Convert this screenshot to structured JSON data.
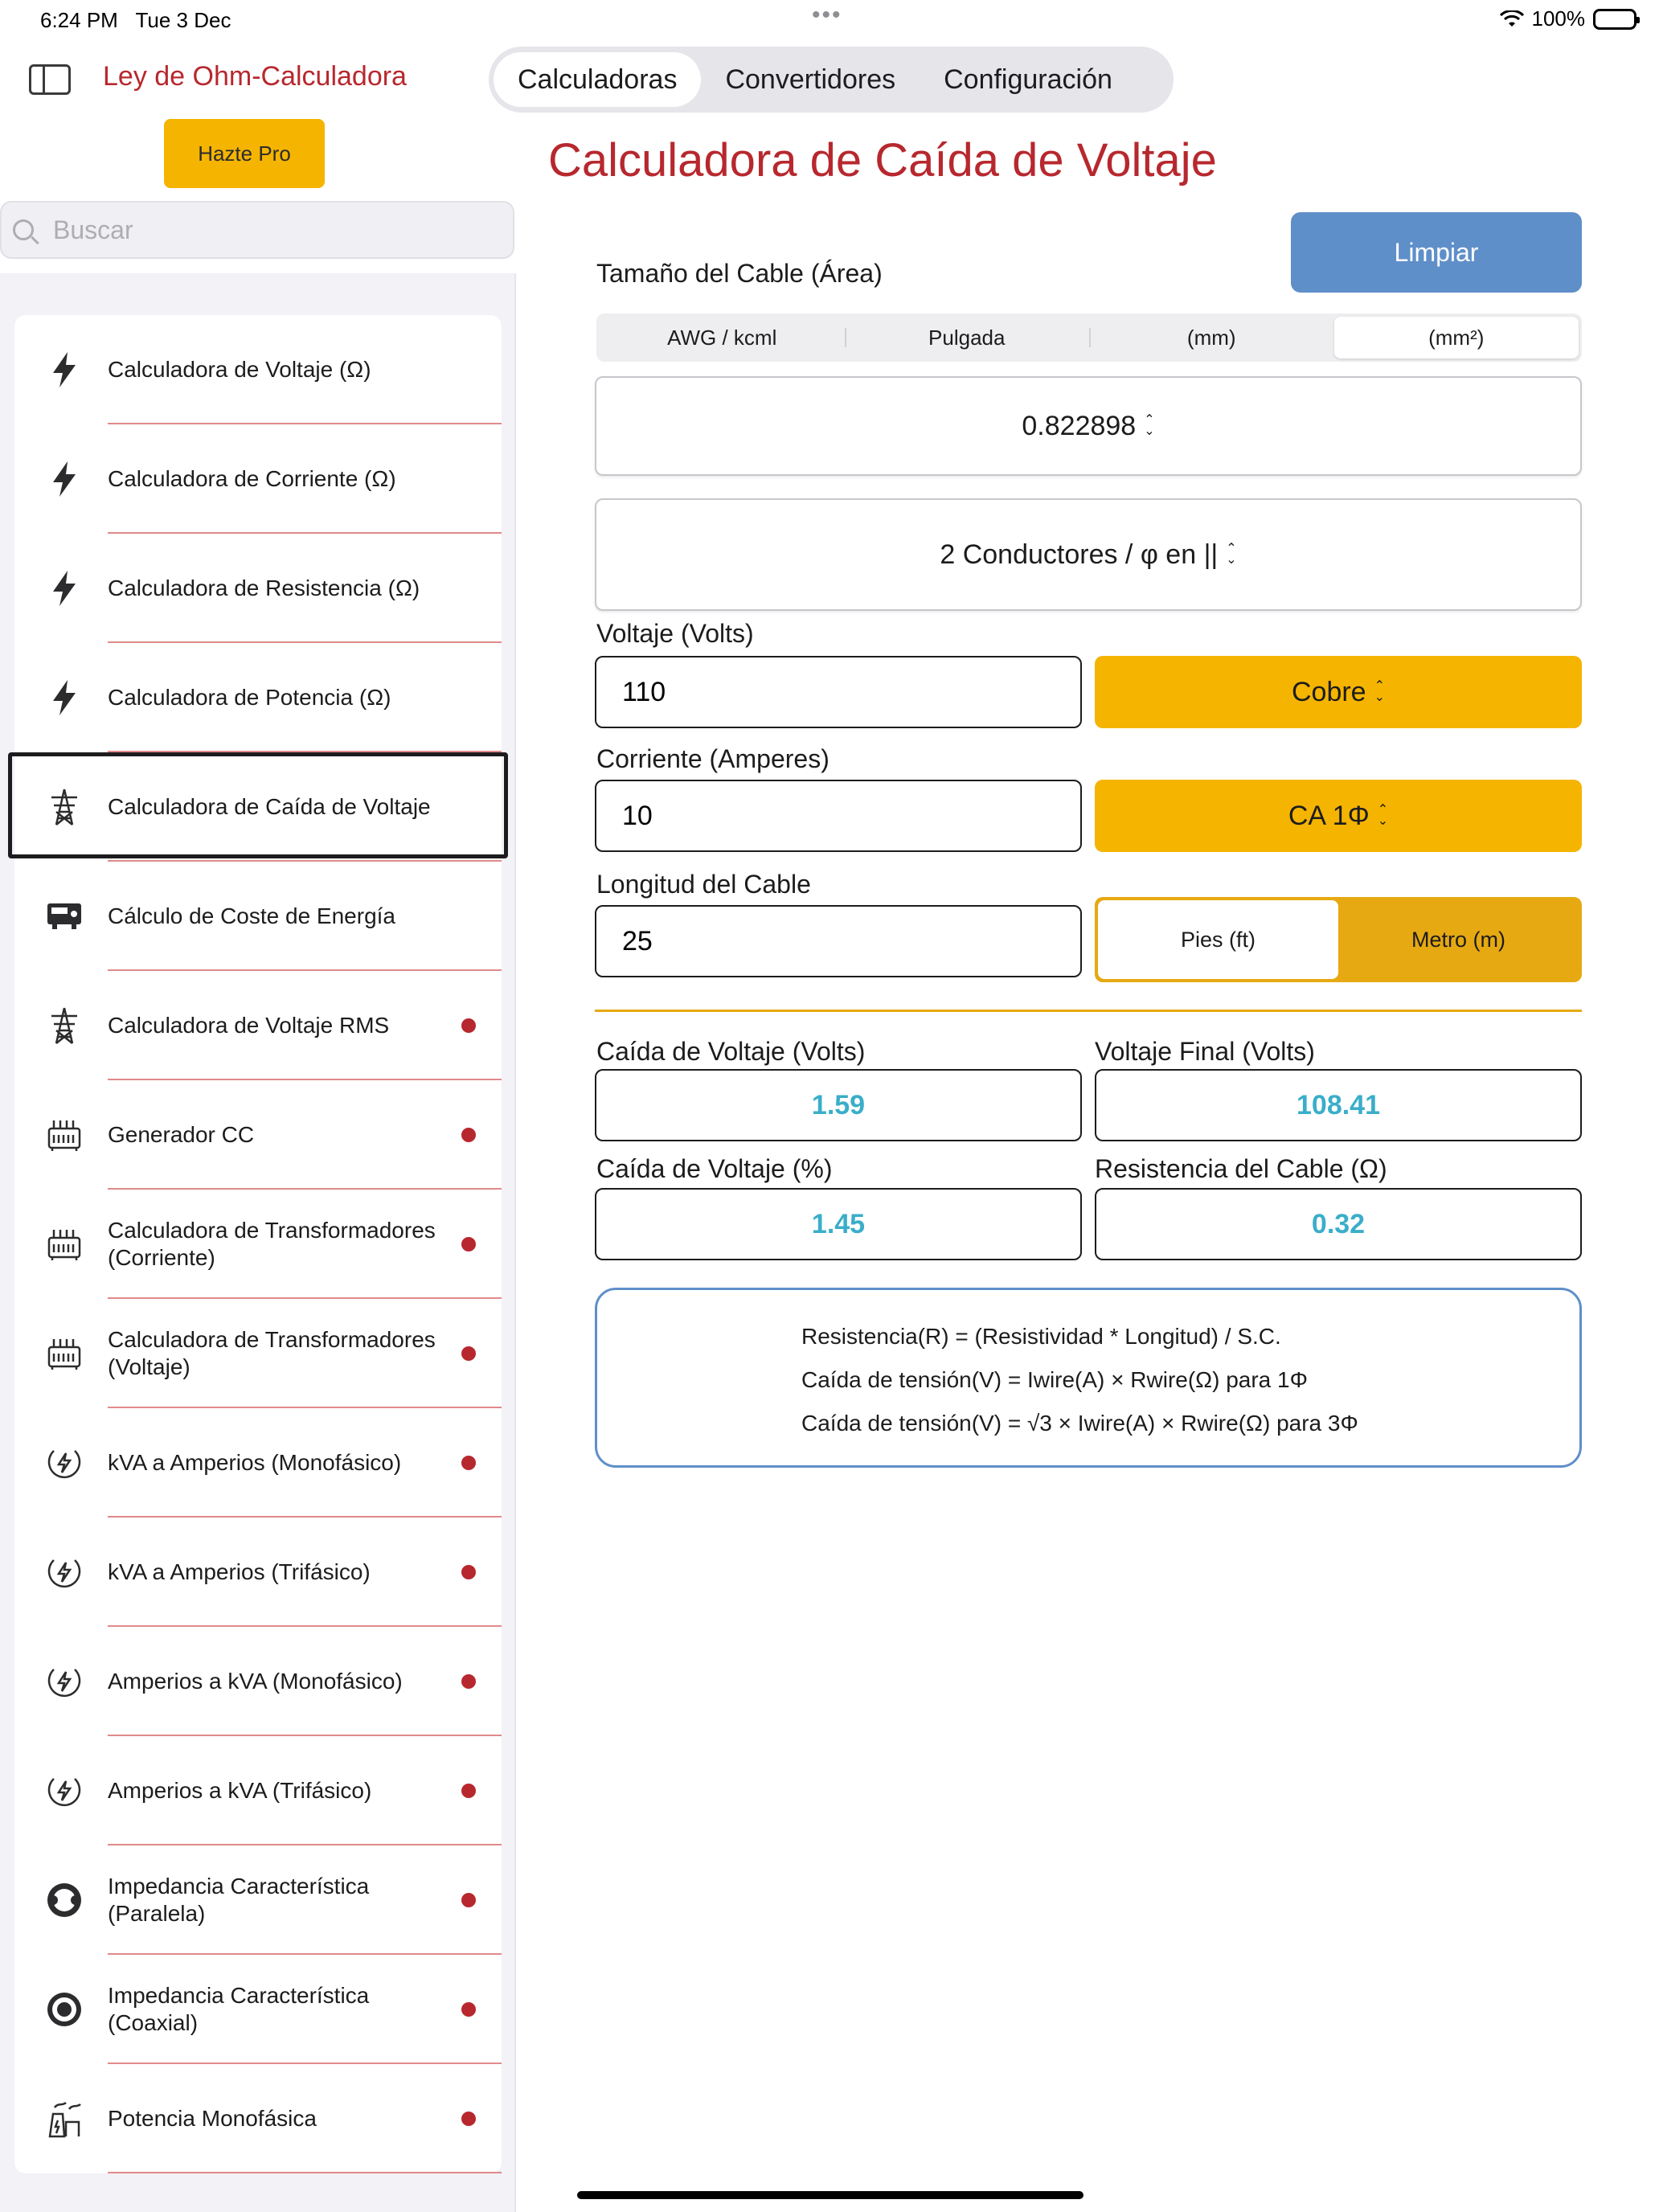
{
  "status_bar": {
    "time": "6:24 PM",
    "date": "Tue 3 Dec",
    "battery": "100%"
  },
  "sidebar": {
    "app_title": "Ley de Ohm-Calculadora",
    "pro_button": "Hazte Pro",
    "search_placeholder": "Buscar",
    "items": [
      {
        "label": "Calculadora de Voltaje (Ω)",
        "icon": "bolt-icon",
        "dot": false
      },
      {
        "label": "Calculadora de Corriente (Ω)",
        "icon": "bolt-icon",
        "dot": false
      },
      {
        "label": "Calculadora de Resistencia (Ω)",
        "icon": "bolt-icon",
        "dot": false
      },
      {
        "label": "Calculadora de Potencia (Ω)",
        "icon": "bolt-icon",
        "dot": false
      },
      {
        "label": "Calculadora de Caída de Voltaje",
        "icon": "power-tower-icon",
        "dot": false,
        "selected": true
      },
      {
        "label": "Cálculo de Coste de Energía",
        "icon": "meter-icon",
        "dot": false
      },
      {
        "label": "Calculadora de Voltaje RMS",
        "icon": "power-tower-icon",
        "dot": true
      },
      {
        "label": "Generador CC",
        "icon": "generator-icon",
        "dot": true
      },
      {
        "label": "Calculadora de Transformadores (Corriente)",
        "icon": "transformer-icon",
        "dot": true
      },
      {
        "label": "Calculadora de Transformadores (Voltaje)",
        "icon": "transformer-icon",
        "dot": true
      },
      {
        "label": "kVA a Amperios (Monofásico)",
        "icon": "circle-bolt-icon",
        "dot": true
      },
      {
        "label": "kVA a Amperios (Trifásico)",
        "icon": "circle-bolt-icon",
        "dot": true
      },
      {
        "label": "Amperios a kVA (Monofásico)",
        "icon": "circle-bolt-icon",
        "dot": true
      },
      {
        "label": "Amperios a kVA (Trifásico)",
        "icon": "circle-bolt-icon",
        "dot": true
      },
      {
        "label": "Impedancia Característica (Paralela)",
        "icon": "parallel-cable-icon",
        "dot": true
      },
      {
        "label": "Impedancia Característica (Coaxial)",
        "icon": "coaxial-icon",
        "dot": true
      },
      {
        "label": "Potencia Monofásica",
        "icon": "plant-icon",
        "dot": true
      }
    ]
  },
  "tabs": [
    "Calculadoras",
    "Convertidores",
    "Configuración"
  ],
  "active_tab": "Calculadoras",
  "page_title": "Calculadora de Caída de Voltaje",
  "clear_button": "Limpiar",
  "cable_size": {
    "label": "Tamaño del Cable (Área)",
    "units": [
      "AWG / kcml",
      "Pulgada",
      "(mm)",
      "(mm²)"
    ],
    "active_unit": "(mm²)",
    "value": "0.822898"
  },
  "conductors": "2 Conductores / φ en ||",
  "voltage": {
    "label": "Voltaje (Volts)",
    "value": "110",
    "material": "Cobre"
  },
  "current": {
    "label": "Corriente (Amperes)",
    "value": "10",
    "phase": "CA 1Φ"
  },
  "length": {
    "label": "Longitud del Cable",
    "value": "25",
    "units": [
      "Pies (ft)",
      "Metro (m)"
    ],
    "active_unit": "Pies (ft)"
  },
  "results": {
    "drop_volts_label": "Caída de Voltaje (Volts)",
    "drop_volts": "1.59",
    "final_volts_label": "Voltaje Final (Volts)",
    "final_volts": "108.41",
    "drop_pct_label": "Caída de Voltaje (%)",
    "drop_pct": "1.45",
    "resistance_label": "Resistencia del Cable (Ω)",
    "resistance": "0.32"
  },
  "formulas": [
    "Resistencia(R) = (Resistividad * Longitud) / S.C.",
    "Caída de tensión(V) = Iwire(A) × Rwire(Ω) para 1Φ",
    "Caída de tensión(V) = √3 × Iwire(A) × Rwire(Ω) para 3Φ"
  ],
  "colors": {
    "brand_red": "#b7282e",
    "accent_yellow": "#f5b400",
    "clear_blue": "#5f8fc9",
    "result_teal": "#3aaec9"
  }
}
